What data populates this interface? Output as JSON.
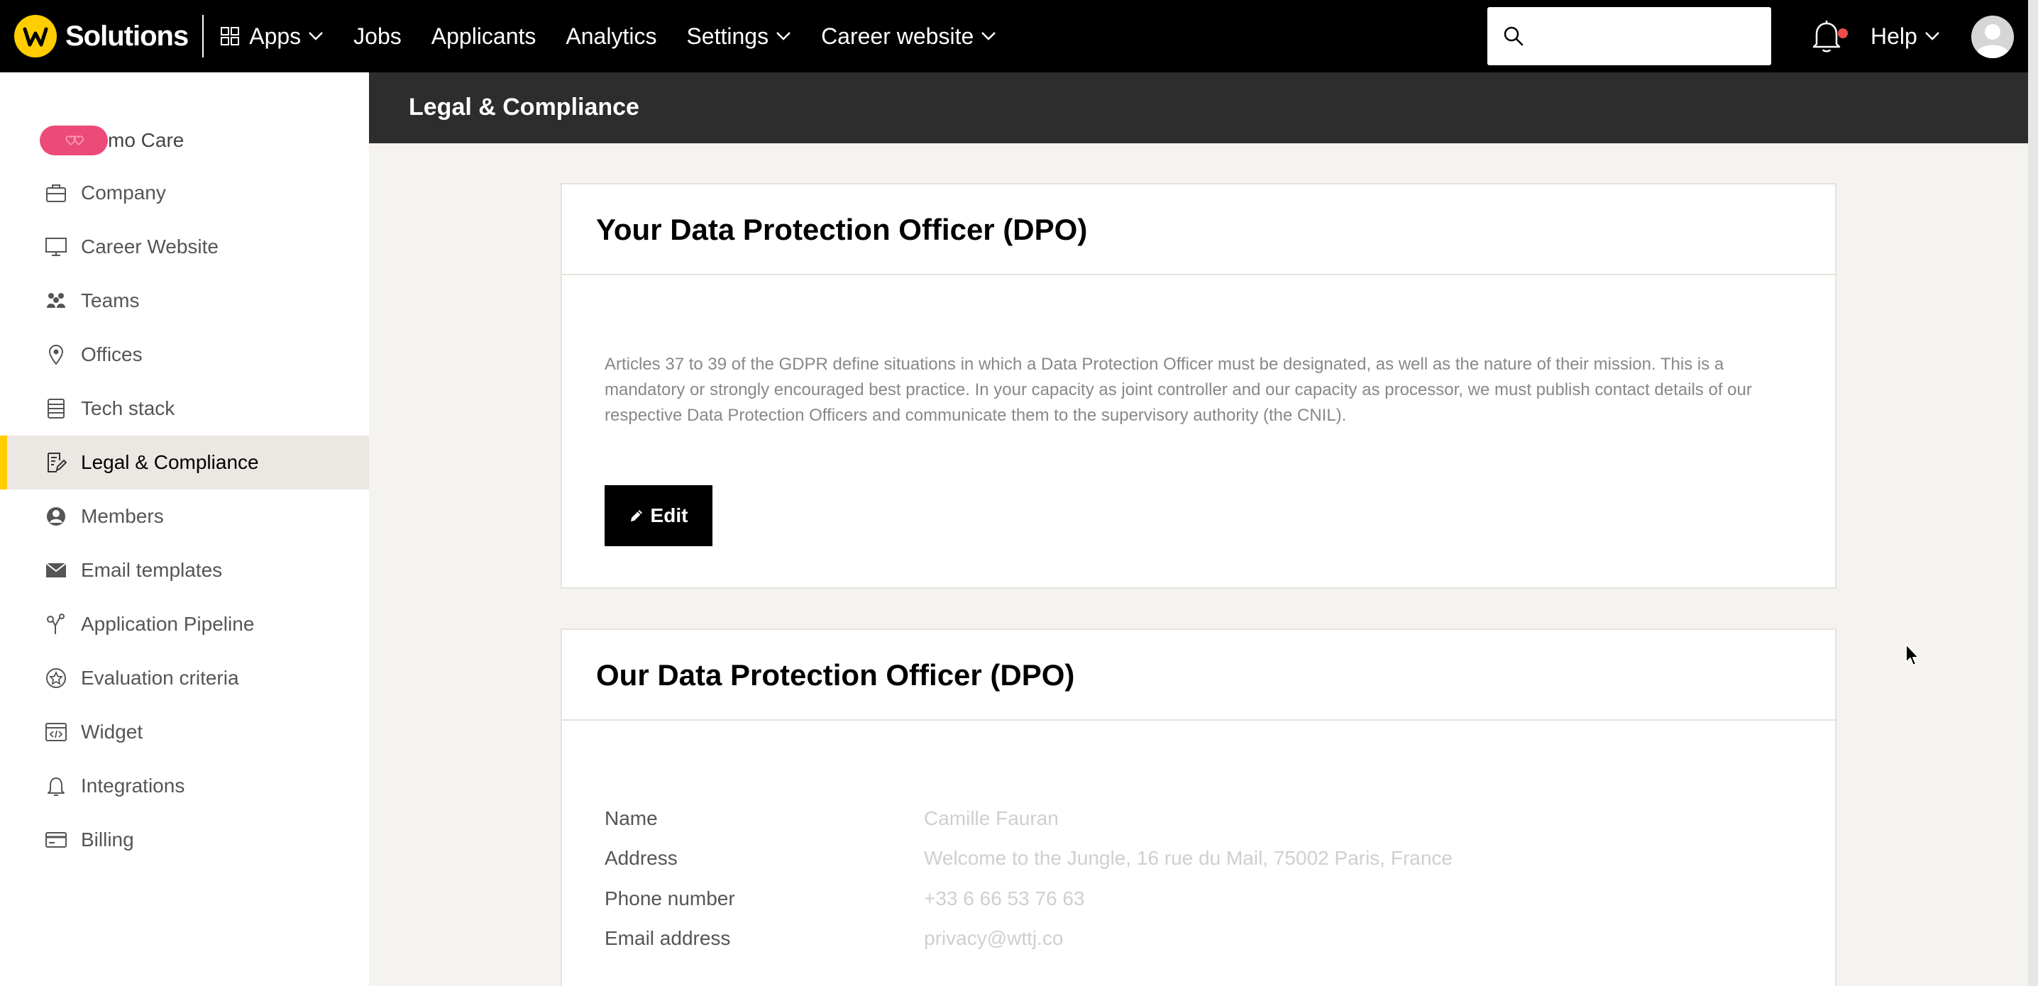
{
  "brand": {
    "name": "Solutions",
    "logo_letter": "W"
  },
  "nav": {
    "apps": "Apps",
    "jobs": "Jobs",
    "applicants": "Applicants",
    "analytics": "Analytics",
    "settings": "Settings",
    "career_website": "Career website",
    "help": "Help"
  },
  "search": {
    "placeholder": "",
    "value": ""
  },
  "notifications": {
    "has_unread": true
  },
  "sidebar": {
    "org_name": "mo Care",
    "items": [
      {
        "label": "Company",
        "icon": "briefcase-icon"
      },
      {
        "label": "Career Website",
        "icon": "monitor-icon"
      },
      {
        "label": "Teams",
        "icon": "people-icon"
      },
      {
        "label": "Offices",
        "icon": "location-pin-icon"
      },
      {
        "label": "Tech stack",
        "icon": "stack-icon"
      },
      {
        "label": "Legal & Compliance",
        "icon": "document-edit-icon",
        "active": true
      },
      {
        "label": "Members",
        "icon": "user-circle-icon"
      },
      {
        "label": "Email templates",
        "icon": "envelope-icon"
      },
      {
        "label": "Application Pipeline",
        "icon": "pipeline-icon"
      },
      {
        "label": "Evaluation criteria",
        "icon": "star-badge-icon"
      },
      {
        "label": "Widget",
        "icon": "code-window-icon"
      },
      {
        "label": "Integrations",
        "icon": "bell-plug-icon"
      },
      {
        "label": "Billing",
        "icon": "credit-card-icon"
      }
    ]
  },
  "page": {
    "title": "Legal & Compliance"
  },
  "your_dpo": {
    "title": "Your Data Protection Officer (DPO)",
    "description": "Articles 37 to 39 of the GDPR define situations in which a Data Protection Officer must be designated, as well as the nature of their mission. This is a mandatory or strongly encouraged best practice. In your capacity as joint controller and our capacity as processor, we must publish contact details of our respective Data Protection Officers and communicate them to the supervisory authority (the CNIL).",
    "edit_label": "Edit"
  },
  "our_dpo": {
    "title": "Our Data Protection Officer (DPO)",
    "fields": [
      {
        "label": "Name",
        "value": "Camille Fauran"
      },
      {
        "label": "Address",
        "value": "Welcome to the Jungle, 16 rue du Mail, 75002 Paris, France"
      },
      {
        "label": "Phone number",
        "value": "+33 6 66 53 76 63"
      },
      {
        "label": "Email address",
        "value": "privacy@wttj.co"
      }
    ]
  },
  "colors": {
    "accent": "#ffcd00",
    "topbar": "#000000",
    "header": "#2d2d2d",
    "background": "#f5f3ef",
    "org_logo": "#ec4a78",
    "notification_dot": "#ee4b4b"
  }
}
